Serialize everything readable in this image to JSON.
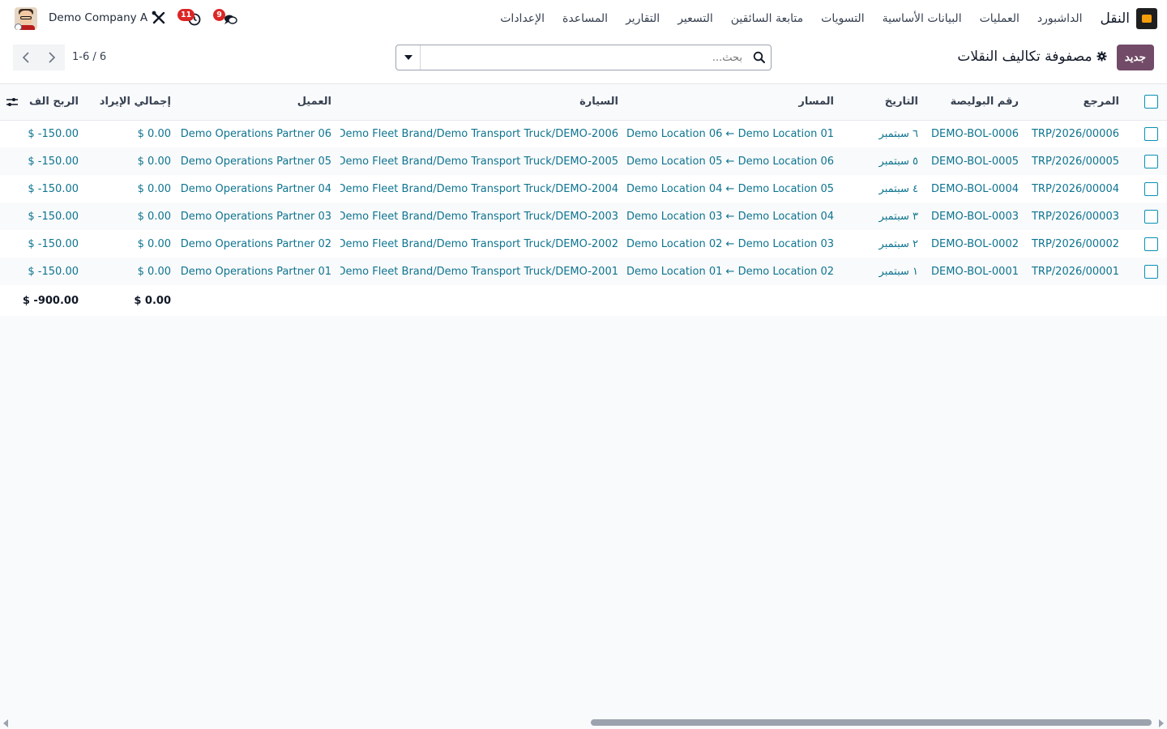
{
  "navbar": {
    "app_name": "النقل",
    "menu": [
      "الداشبورد",
      "العمليات",
      "البيانات الأساسية",
      "التسويات",
      "متابعة السائقين",
      "التسعير",
      "التقارير",
      "المساعدة",
      "الإعدادات"
    ],
    "company": "Demo Company A",
    "activity_count": "11",
    "messages_count": "9"
  },
  "control": {
    "new_button": "جديد",
    "view_title": "مصفوفة تكاليف النقلات",
    "search_placeholder": "بحث...",
    "pager": "1-6 / 6"
  },
  "table": {
    "columns": {
      "ref": "المرجع",
      "bol": "رقم البوليصة",
      "date": "التاريخ",
      "route": "المسار",
      "vehicle": "السيارة",
      "customer": "العميل",
      "revenue": "إجمالي الإيراد",
      "profit": "الربح الف"
    },
    "rows": [
      {
        "ref": "TRP/2026/00006",
        "bol": "DEMO-BOL-0006",
        "date": "٦ سبتمبر",
        "route": "Demo Location 06 ← Demo Location 01",
        "vehicle": "Demo Fleet Brand/Demo Transport Truck/DEMO-2006",
        "customer": "Demo Operations Partner 06",
        "revenue": "$ 0.00",
        "profit": "$ -150.00"
      },
      {
        "ref": "TRP/2026/00005",
        "bol": "DEMO-BOL-0005",
        "date": "٥ سبتمبر",
        "route": "Demo Location 05 ← Demo Location 06",
        "vehicle": "Demo Fleet Brand/Demo Transport Truck/DEMO-2005",
        "customer": "Demo Operations Partner 05",
        "revenue": "$ 0.00",
        "profit": "$ -150.00"
      },
      {
        "ref": "TRP/2026/00004",
        "bol": "DEMO-BOL-0004",
        "date": "٤ سبتمبر",
        "route": "Demo Location 04 ← Demo Location 05",
        "vehicle": "Demo Fleet Brand/Demo Transport Truck/DEMO-2004",
        "customer": "Demo Operations Partner 04",
        "revenue": "$ 0.00",
        "profit": "$ -150.00"
      },
      {
        "ref": "TRP/2026/00003",
        "bol": "DEMO-BOL-0003",
        "date": "٣ سبتمبر",
        "route": "Demo Location 03 ← Demo Location 04",
        "vehicle": "Demo Fleet Brand/Demo Transport Truck/DEMO-2003",
        "customer": "Demo Operations Partner 03",
        "revenue": "$ 0.00",
        "profit": "$ -150.00"
      },
      {
        "ref": "TRP/2026/00002",
        "bol": "DEMO-BOL-0002",
        "date": "٢ سبتمبر",
        "route": "Demo Location 02 ← Demo Location 03",
        "vehicle": "Demo Fleet Brand/Demo Transport Truck/DEMO-2002",
        "customer": "Demo Operations Partner 02",
        "revenue": "$ 0.00",
        "profit": "$ -150.00"
      },
      {
        "ref": "TRP/2026/00001",
        "bol": "DEMO-BOL-0001",
        "date": "١ سبتمبر",
        "route": "Demo Location 01 ← Demo Location 02",
        "vehicle": "Demo Fleet Brand/Demo Transport Truck/DEMO-2001",
        "customer": "Demo Operations Partner 01",
        "revenue": "$ 0.00",
        "profit": "$ -150.00"
      }
    ],
    "totals": {
      "revenue": "$ 0.00",
      "profit": "$ -900.00"
    }
  },
  "colors": {
    "primary": "#714b67",
    "link": "#0e7490",
    "badge": "#dc2626",
    "checkbox": "#0891b2"
  }
}
